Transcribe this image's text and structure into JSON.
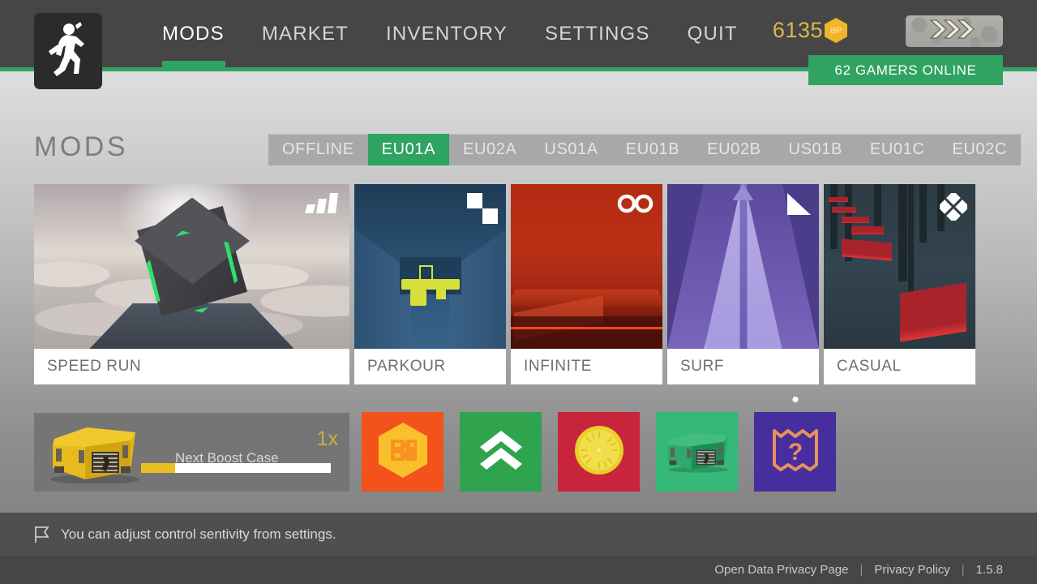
{
  "header": {
    "logo_icon": "running-man-icon",
    "nav": [
      {
        "label": "MODS",
        "active": true
      },
      {
        "label": "MARKET",
        "active": false
      },
      {
        "label": "INVENTORY",
        "active": false
      },
      {
        "label": "SETTINGS",
        "active": false
      },
      {
        "label": "QUIT",
        "active": false
      }
    ],
    "currency": {
      "value": "6135",
      "badge_label": "BP",
      "badge_icon": "bp-hexagon-icon",
      "color": "#d9b94b"
    },
    "rank_badge": {
      "icon": "triple-chevron-rank-icon",
      "chevrons": 3
    },
    "online": {
      "label": "62 GAMERS ONLINE",
      "color": "#2fa360"
    },
    "accent_color": "#2fa360"
  },
  "page": {
    "title": "MODS"
  },
  "servers": {
    "tabs": [
      {
        "label": "OFFLINE",
        "active": false
      },
      {
        "label": "EU01A",
        "active": true
      },
      {
        "label": "EU02A",
        "active": false
      },
      {
        "label": "US01A",
        "active": false
      },
      {
        "label": "EU01B",
        "active": false
      },
      {
        "label": "EU02B",
        "active": false
      },
      {
        "label": "US01B",
        "active": false
      },
      {
        "label": "EU01C",
        "active": false
      },
      {
        "label": "EU02C",
        "active": false
      }
    ]
  },
  "mods": [
    {
      "label": "SPEED RUN",
      "badge_icon": "three-bars-icon"
    },
    {
      "label": "PARKOUR",
      "badge_icon": "two-steps-icon"
    },
    {
      "label": "INFINITE",
      "badge_icon": "infinity-icon"
    },
    {
      "label": "SURF",
      "badge_icon": "ramp-triangle-icon"
    },
    {
      "label": "CASUAL",
      "badge_icon": "diamond-icon"
    }
  ],
  "boost": {
    "crate_icon": "yellow-case-icon",
    "title": "Next Boost Case",
    "multiplier": "1x",
    "progress_percent": 18,
    "fill_color": "#e8c021"
  },
  "tiles": [
    {
      "name": "buy-bp-tile",
      "icon": "bp-hexagon-icon",
      "bg": "#f4521b",
      "has_dot": false
    },
    {
      "name": "upgrade-tile",
      "icon": "double-chevron-up-icon",
      "bg": "#2fa34e",
      "has_dot": false
    },
    {
      "name": "coin-tile",
      "icon": "gold-coin-icon",
      "bg": "#c8243c",
      "has_dot": false
    },
    {
      "name": "case-tile",
      "icon": "green-case-icon",
      "bg": "#36b878",
      "has_dot": false
    },
    {
      "name": "mystery-map-tile",
      "icon": "map-question-icon",
      "bg": "#462e9e",
      "has_dot": true
    }
  ],
  "tip": {
    "icon": "flag-icon",
    "text": "You can adjust control sentivity from settings."
  },
  "footer": {
    "data_privacy_label": "Open Data Privacy Page",
    "separator": "|",
    "privacy_policy_label": "Privacy Policy",
    "version": "1.5.8"
  }
}
